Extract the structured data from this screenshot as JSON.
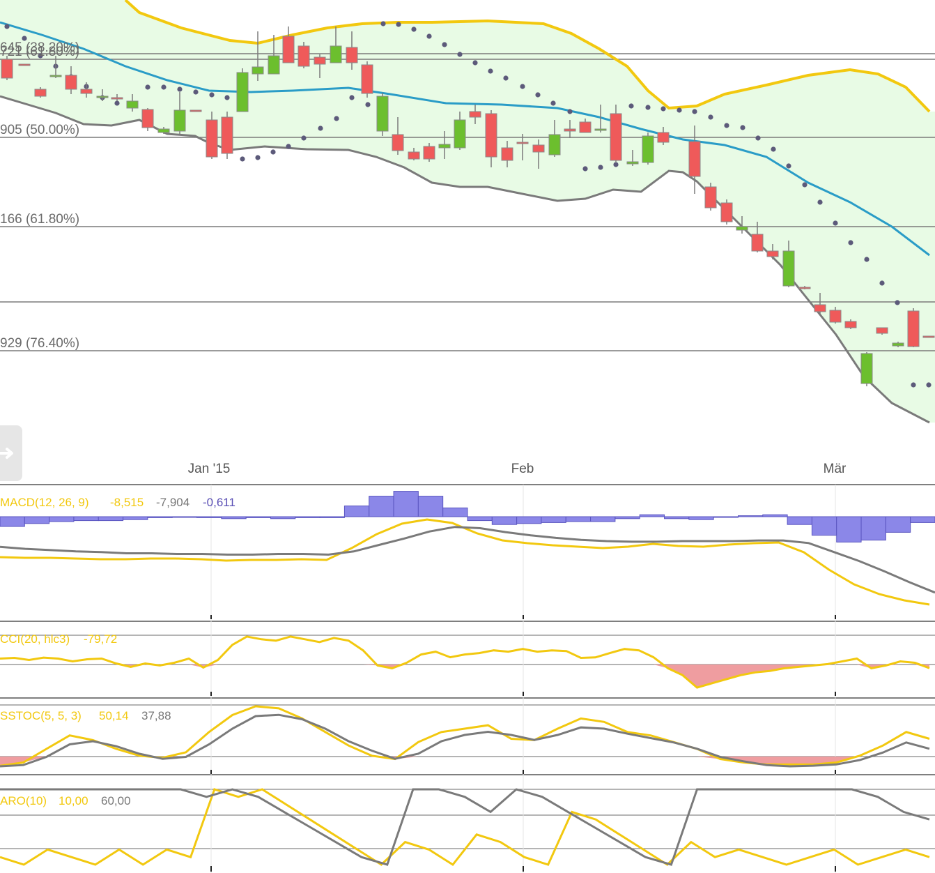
{
  "colors": {
    "band_fill": "#e8fbe5",
    "band_upper": "#f2c80f",
    "band_lower": "#7a7a7a",
    "sma": "#2a9cc7",
    "sar": "#5c5a7a",
    "up_candle": "#6cbf2e",
    "down_candle": "#ef5a5a",
    "macd_hist": "#8b87e8",
    "indicator_yellow": "#f2c80f",
    "indicator_gray": "#7a7a7a",
    "neg_fill": "#ef9da0",
    "pos_fill": "#b8f0a0",
    "gridline": "#7a7a7a"
  },
  "fib_labels": [
    {
      "text": "645 (38.20%)"
    },
    {
      "text": "721 (61.80%)"
    },
    {
      "text": "905 (50.00%)"
    },
    {
      "text": "166 (61.80%)"
    },
    {
      "text": "929 (76.40%)"
    }
  ],
  "x_axis": [
    "Jan '15",
    "Feb",
    "Mär"
  ],
  "indicators": {
    "macd": {
      "name": "MACD(12, 26, 9)",
      "v1": "-8,515",
      "v2": "-7,904",
      "v3": "-0,611"
    },
    "cci": {
      "name": "CCI(20, hlc3)",
      "v1": "-79,72"
    },
    "sstoc": {
      "name": "SSTOC(5, 5, 3)",
      "v1": "50,14",
      "v2": "37,88"
    },
    "aro": {
      "name": "ARO(10)",
      "v1": "10,00",
      "v2": "60,00"
    }
  },
  "share_icon": "share-arrow-icon",
  "chart_data": [
    {
      "type": "candlestick",
      "ohlc": [
        [
          27,
          20,
          34,
          13
        ],
        [
          34,
          34,
          35,
          34
        ],
        [
          46,
          49,
          49,
          46
        ],
        [
          49,
          47,
          42,
          54
        ],
        [
          36,
          36,
          31,
          29
        ],
        [
          50,
          51,
          52,
          46
        ],
        [
          47,
          50,
          47,
          52
        ],
        [
          51,
          51,
          53,
          49
        ],
        [
          54,
          57,
          56,
          59
        ],
        [
          60,
          61,
          69,
          73
        ],
        [
          67,
          68,
          74,
          72
        ],
        [
          65,
          70,
          74,
          61
        ],
        [
          66,
          58,
          56,
          58
        ],
        [
          67,
          69,
          70,
          73
        ],
        [
          85,
          85,
          77,
          85
        ],
        [
          73,
          71,
          85,
          85
        ],
        [
          52,
          50,
          60,
          40
        ],
        [
          43,
          30,
          32,
          43
        ],
        [
          26,
          30,
          24,
          32
        ],
        [
          16,
          11,
          21,
          23
        ],
        [
          14,
          2,
          11,
          20
        ],
        [
          9,
          26,
          23,
          14
        ],
        [
          24,
          22,
          29,
          19
        ],
        [
          26,
          30,
          23,
          22
        ],
        [
          48,
          52,
          54,
          49
        ],
        [
          57,
          54,
          64,
          67
        ],
        [
          70,
          81,
          74,
          63
        ],
        [
          78,
          73,
          77,
          79
        ],
        [
          70,
          56,
          72,
          69
        ],
        [
          68,
          72,
          70,
          70
        ],
        [
          75,
          73,
          79,
          78
        ],
        [
          78,
          78,
          79,
          79
        ],
        [
          88,
          88,
          76,
          75
        ],
        [
          64,
          76,
          77,
          78
        ],
        [
          75,
          81,
          79,
          81
        ],
        [
          75,
          76,
          76,
          74
        ],
        [
          80,
          71,
          80,
          79
        ],
        [
          76,
          77,
          76,
          72
        ],
        [
          82,
          73,
          71,
          64
        ],
        [
          73,
          69,
          72,
          74
        ],
        [
          78,
          74,
          77,
          80
        ],
        [
          79,
          73,
          71,
          69
        ],
        [
          73,
          61,
          65,
          70
        ],
        [
          77,
          79,
          78,
          78
        ],
        [
          67,
          65,
          65,
          67
        ],
        [
          62,
          69,
          60,
          60
        ],
        [
          81,
          82,
          83,
          82
        ],
        [
          95,
          96,
          98,
          97
        ],
        [
          107,
          108,
          106,
          106
        ],
        [
          113,
          113,
          117,
          116
        ],
        [
          122,
          119,
          116,
          126
        ],
        [
          145,
          132,
          149,
          142
        ],
        [
          133,
          135,
          141,
          136
        ],
        [
          130,
          138,
          131,
          132
        ],
        [
          128,
          130,
          132,
          127
        ],
        [
          143,
          150,
          150,
          147
        ],
        [
          140,
          144,
          146,
          146
        ],
        [
          140,
          138,
          142,
          144
        ],
        [
          146,
          145,
          142,
          145
        ],
        [
          155,
          153,
          158,
          152
        ],
        [
          149,
          141,
          146,
          148
        ]
      ]
    },
    {
      "type": "line",
      "name": "MACD",
      "series": [
        {
          "values": [
            -1.7,
            -1.8,
            -1.8,
            -1.9,
            -2.0,
            -2.0,
            -1.9,
            -1.9,
            -2.0,
            -2.2,
            -2.1,
            -2.1,
            -2.0,
            -2.1,
            -0.4,
            1.6,
            3.1,
            3.7,
            3.2,
            1.7,
            0.7,
            0.3,
            0.0,
            -0.2,
            -0.4,
            -0.2,
            0.2,
            -0.1,
            -0.2,
            0.1,
            0.3,
            0.4,
            -1.0,
            -3.5,
            -5.6,
            -7.0,
            -7.9,
            -8.5
          ]
        },
        {
          "values": [
            -0.8,
            -1.1,
            -1.3,
            -1.5,
            -1.6,
            -1.8,
            -1.8,
            -1.9,
            -1.9,
            -2.0,
            -2.0,
            -1.9,
            -1.9,
            -2.0,
            -1.5,
            -0.5,
            0.5,
            1.6,
            2.3,
            2.1,
            1.5,
            1.0,
            0.6,
            0.3,
            0.1,
            0.0,
            0.0,
            0.1,
            0.1,
            0.1,
            0.2,
            0.2,
            -0.2,
            -1.6,
            -3.0,
            -4.6,
            -6.3,
            -7.9
          ]
        },
        {
          "values": [
            -1.0,
            -0.7,
            -0.5,
            -0.4,
            -0.4,
            -0.3,
            -0.1,
            0.0,
            -0.1,
            -0.2,
            -0.1,
            -0.2,
            -0.1,
            -0.1,
            1.1,
            2.1,
            2.6,
            2.1,
            0.9,
            -0.4,
            -0.8,
            -0.7,
            -0.6,
            -0.5,
            -0.5,
            -0.2,
            0.2,
            -0.2,
            -0.3,
            0.0,
            0.1,
            0.2,
            -0.8,
            -1.9,
            -2.6,
            -2.4,
            -1.6,
            -0.6
          ]
        }
      ]
    },
    {
      "type": "line",
      "name": "CCI",
      "series": [
        {
          "values": [
            -10,
            -5,
            -20,
            -3,
            -10,
            -30,
            -15,
            -10,
            -45,
            -70,
            -45,
            -60,
            -40,
            -10,
            -75,
            -20,
            90,
            150,
            130,
            120,
            150,
            130,
            110,
            140,
            120,
            50,
            -60,
            -80,
            -40,
            20,
            40,
            0,
            20,
            30,
            50,
            40,
            60,
            40,
            50,
            45,
            -5,
            -1,
            30,
            60,
            50,
            0,
            -80,
            -130,
            -220,
            -190,
            -160,
            -130,
            -110,
            -100,
            -80,
            -70,
            -60,
            -50,
            -30,
            -10,
            -80,
            -60,
            -30,
            -40,
            -79
          ]
        }
      ]
    },
    {
      "type": "line",
      "name": "SSTOC",
      "series": [
        {
          "values": [
            10,
            15,
            35,
            55,
            48,
            35,
            25,
            22,
            30,
            60,
            85,
            98,
            95,
            80,
            60,
            40,
            25,
            20,
            45,
            60,
            65,
            70,
            50,
            48,
            65,
            80,
            75,
            60,
            55,
            45,
            35,
            20,
            15,
            12,
            12,
            12,
            15,
            25,
            40,
            60,
            50
          ]
        },
        {
          "values": [
            10,
            12,
            25,
            45,
            50,
            42,
            30,
            22,
            25,
            45,
            70,
            90,
            92,
            85,
            70,
            50,
            35,
            22,
            30,
            50,
            60,
            65,
            60,
            52,
            60,
            72,
            70,
            62,
            55,
            48,
            38,
            25,
            18,
            12,
            10,
            11,
            13,
            20,
            32,
            48,
            38
          ]
        }
      ]
    },
    {
      "type": "line",
      "name": "ARO",
      "series": [
        {
          "values": [
            10,
            0,
            20,
            10,
            0,
            20,
            0,
            20,
            10,
            100,
            90,
            100,
            80,
            60,
            40,
            20,
            0,
            30,
            20,
            0,
            40,
            30,
            10,
            0,
            70,
            60,
            40,
            20,
            0,
            30,
            10,
            20,
            10,
            0,
            10,
            20,
            0,
            10,
            20,
            10
          ]
        },
        {
          "values": [
            100,
            100,
            100,
            100,
            100,
            100,
            100,
            100,
            90,
            100,
            90,
            70,
            50,
            30,
            10,
            0,
            100,
            100,
            90,
            70,
            100,
            90,
            70,
            50,
            30,
            10,
            0,
            100,
            100,
            100,
            100,
            100,
            100,
            100,
            90,
            70,
            60
          ]
        }
      ]
    }
  ]
}
